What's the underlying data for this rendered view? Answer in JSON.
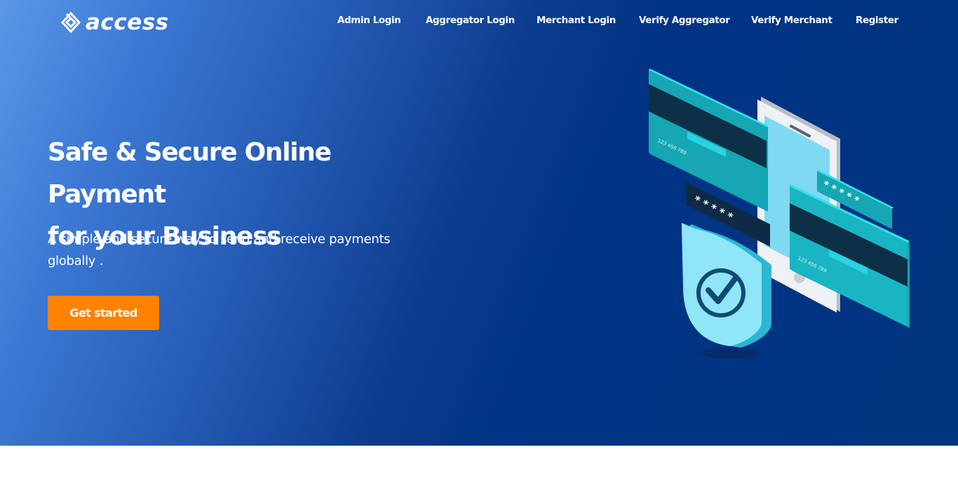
{
  "brand": {
    "name": "access",
    "icon": "access-diamond-logo-icon"
  },
  "nav": {
    "items": [
      {
        "label": "Admin Login"
      },
      {
        "label": "Aggregator Login"
      },
      {
        "label": "Merchant Login"
      },
      {
        "label": "Verify Aggregator"
      },
      {
        "label": "Verify Merchant"
      },
      {
        "label": "Register"
      }
    ]
  },
  "hero": {
    "headline_line1": "Safe & Secure Online Payment",
    "headline_line2": "for your Business",
    "subtext": "A simple and secure way to send and receive payments globally .",
    "cta_label": "Get started",
    "illustration": {
      "icon": "secure-payment-illustration",
      "card_number": "123 456 789",
      "pin_mask": "* * * * *"
    }
  },
  "colors": {
    "accent": "#ff8200",
    "hero_dark": "#00357f",
    "hero_light": "#5b97e6",
    "teal": "#16b9c6"
  }
}
